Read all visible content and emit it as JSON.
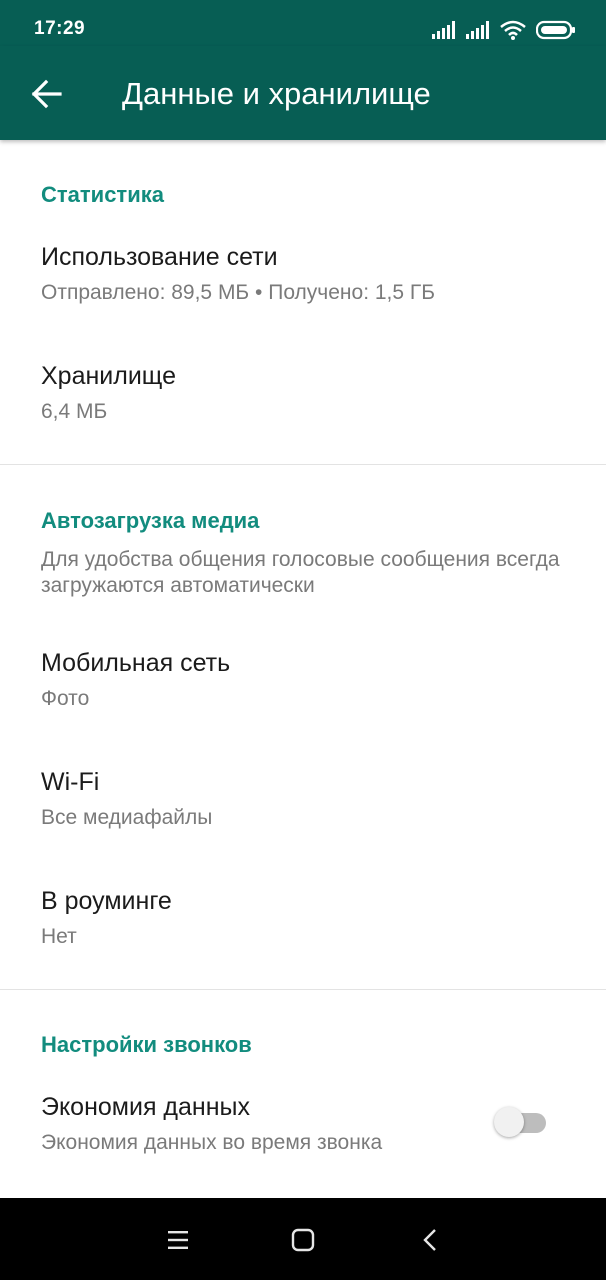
{
  "status_bar": {
    "time": "17:29",
    "icons": [
      "signal-icon",
      "signal-icon",
      "wifi-icon",
      "battery-icon"
    ]
  },
  "app_bar": {
    "title": "Данные и хранилище",
    "back_icon": "arrow-left-icon"
  },
  "sections": {
    "stats": {
      "header": "Статистика",
      "network_usage": {
        "title": "Использование сети",
        "subtitle": "Отправлено: 89,5 МБ • Получено: 1,5 ГБ"
      },
      "storage": {
        "title": "Хранилище",
        "subtitle": "6,4 МБ"
      }
    },
    "media_autodownload": {
      "header": "Автозагрузка медиа",
      "note": "Для удобства общения голосовые сообщения всегда загружаются автоматически",
      "mobile": {
        "title": "Мобильная сеть",
        "subtitle": "Фото"
      },
      "wifi": {
        "title": "Wi-Fi",
        "subtitle": "Все медиафайлы"
      },
      "roaming": {
        "title": "В роуминге",
        "subtitle": "Нет"
      }
    },
    "calls": {
      "header": "Настройки звонков",
      "data_saver": {
        "title": "Экономия данных",
        "subtitle": "Экономия данных во время звонка",
        "enabled": false
      }
    }
  },
  "nav_bar": {
    "icons": [
      "menu-icon",
      "home-icon",
      "back-icon"
    ]
  },
  "colors": {
    "primary": "#075e54",
    "accent": "#128c7e",
    "text_primary": "#1b1b1b",
    "text_secondary": "#7a7a7a"
  }
}
